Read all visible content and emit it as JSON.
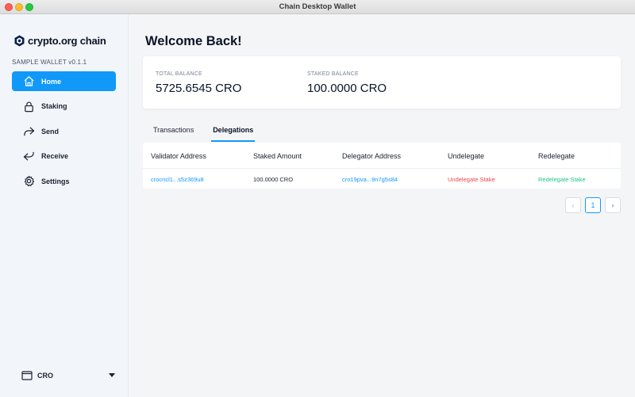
{
  "window": {
    "title": "Chain Desktop Wallet"
  },
  "sidebar": {
    "brand": "crypto.org chain",
    "wallet_name": "SAMPLE WALLET v0.1.1",
    "items": [
      {
        "label": "Home",
        "icon": "home-icon"
      },
      {
        "label": "Staking",
        "icon": "lock-icon"
      },
      {
        "label": "Send",
        "icon": "send-icon"
      },
      {
        "label": "Receive",
        "icon": "receive-icon"
      },
      {
        "label": "Settings",
        "icon": "gear-icon"
      }
    ],
    "active_item": "Home",
    "network": {
      "label": "CRO",
      "icon": "wallet-icon"
    }
  },
  "main": {
    "welcome": "Welcome Back!",
    "balances": {
      "total_label": "TOTAL BALANCE",
      "total_value": "5725.6545 CRO",
      "staked_label": "STAKED BALANCE",
      "staked_value": "100.0000 CRO"
    },
    "tabs": [
      "Transactions",
      "Delegations"
    ],
    "active_tab": "Delegations",
    "table": {
      "headers": [
        "Validator Address",
        "Staked Amount",
        "Delegator Address",
        "Undelegate",
        "Redelegate"
      ],
      "rows": [
        [
          "crocncl1...s5z369u8",
          "100.0000 CRO",
          "cro19pva...9n7g5s84",
          "Undelegate Stake",
          "Redelegate Stake"
        ]
      ]
    },
    "pagination": {
      "prev": "‹",
      "page": "1",
      "next": "›"
    }
  },
  "colors": {
    "accent": "#1199fa",
    "danger": "#f2444a",
    "success": "#20c38a"
  }
}
